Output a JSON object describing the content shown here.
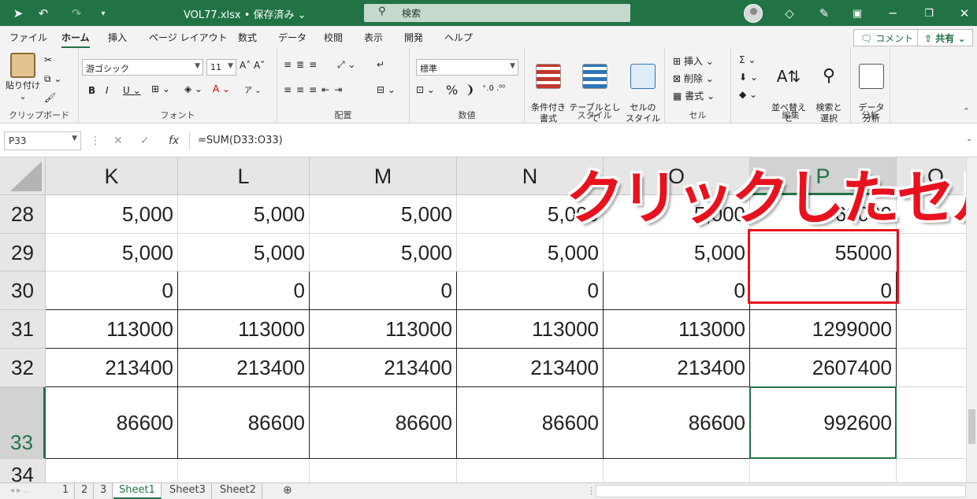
{
  "title_bar": {
    "filename": "VOL77.xlsx • 保存済み ⌄",
    "search_placeholder": "検索"
  },
  "ribbon_tabs": [
    "ファイル",
    "ホーム",
    "挿入",
    "ページ レイアウト",
    "数式",
    "データ",
    "校閲",
    "表示",
    "開発",
    "ヘルプ"
  ],
  "ribbon_actions": {
    "comment": "コメント",
    "share": "共有"
  },
  "clipboard": {
    "paste": "貼り付け",
    "label": "クリップボード"
  },
  "font": {
    "name": "游ゴシック",
    "size": "11",
    "label": "フォント"
  },
  "alignment": {
    "label": "配置"
  },
  "number": {
    "format": "標準",
    "percent": "%",
    "comma": "❩",
    "label": "数値"
  },
  "styles": {
    "conditional": "条件付き\n書式",
    "table": "テーブルとして\n書式設定",
    "cell_style": "セルの\nスタイル",
    "label": "スタイル"
  },
  "cells": {
    "insert": "挿入",
    "delete": "削除",
    "format": "書式",
    "label": "セル"
  },
  "editing": {
    "sort": "並べ替えと\nフィルター",
    "find": "検索と\n選択",
    "label": "編集"
  },
  "analysis": {
    "data": "データ\n分析",
    "label": "分析"
  },
  "formula_bar": {
    "name_box": "P33",
    "fx": "fx",
    "formula": "=SUM(D33:O33)"
  },
  "columns": [
    "K",
    "L",
    "M",
    "N",
    "O",
    "P",
    "Q"
  ],
  "selected_column": "P",
  "rows": [
    {
      "num": "28",
      "values": [
        "5,000",
        "5,000",
        "5,000",
        "5,000",
        "5,000",
        "60000"
      ]
    },
    {
      "num": "29",
      "values": [
        "5,000",
        "5,000",
        "5,000",
        "5,000",
        "5,000",
        "55000"
      ]
    },
    {
      "num": "30",
      "values": [
        "0",
        "0",
        "0",
        "0",
        "0",
        "0"
      ]
    },
    {
      "num": "31",
      "values": [
        "113000",
        "113000",
        "113000",
        "113000",
        "113000",
        "1299000"
      ]
    },
    {
      "num": "32",
      "values": [
        "213400",
        "213400",
        "213400",
        "213400",
        "213400",
        "2607400"
      ]
    },
    {
      "num": "33",
      "values": [
        "86600",
        "86600",
        "86600",
        "86600",
        "86600",
        "992600"
      ]
    },
    {
      "num": "34",
      "values": [
        "",
        "",
        "",
        "",
        "",
        ""
      ]
    }
  ],
  "annotation": {
    "text": "クリックしたセル",
    "color": "#e8121e"
  },
  "sheet_tabs": [
    "1",
    "2",
    "3",
    "Sheet1",
    "Sheet3",
    "Sheet2"
  ],
  "active_sheet": "Sheet1",
  "accent_color": "#217346"
}
